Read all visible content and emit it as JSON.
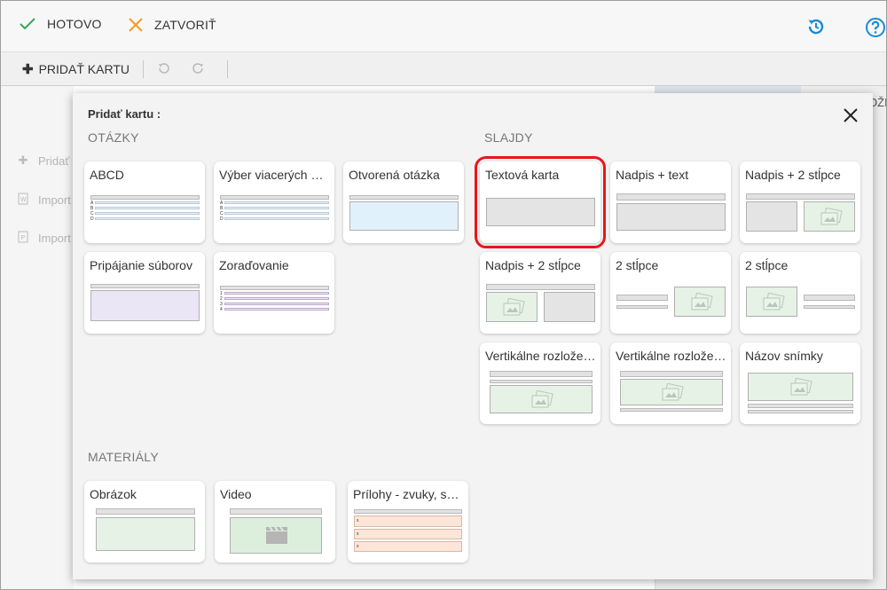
{
  "toolbar": {
    "done_label": "HOTOVO",
    "close_label": "ZATVORIŤ",
    "add_card_label": "PRIDAŤ KARTU"
  },
  "background": {
    "sidebar_items": [
      "Pridať",
      "Import",
      "Import"
    ],
    "zoom_fragment": "OŽI"
  },
  "dialog": {
    "title": "Pridať kartu :",
    "sections": {
      "questions": {
        "title": "OTÁZKY",
        "cards": [
          "ABCD",
          "Výber viacerých možností",
          "Otvorená otázka",
          "Pripájanie súborov",
          "Zoraďovanie"
        ]
      },
      "slides": {
        "title": "SLAJDY",
        "cards": [
          "Textová karta",
          "Nadpis + text",
          "Nadpis + 2 stĺpce",
          "Nadpis + 2 stĺpce",
          "2 stĺpce",
          "2 stĺpce",
          "Vertikálne rozloženie",
          "Vertikálne rozloženie",
          "Názov snímky"
        ]
      },
      "materials": {
        "title": "MATERIÁLY",
        "cards": [
          "Obrázok",
          "Video",
          "Prílohy - zvuky, súbory"
        ]
      }
    },
    "selected_card": "Textová karta"
  },
  "thumb_letters": {
    "abcd": [
      "A",
      "B",
      "C",
      "D"
    ],
    "order": [
      "1",
      "2",
      "3",
      "4"
    ],
    "attach": [
      "x",
      "x",
      "x"
    ]
  },
  "colors": {
    "check": "#3aa55b",
    "close_x": "#f39a1e",
    "accent_blue": "#1a8ad4",
    "selection": "#e8161c"
  }
}
